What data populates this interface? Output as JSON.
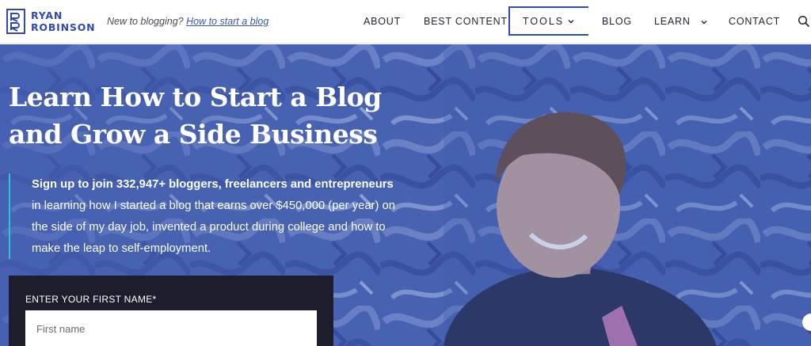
{
  "header": {
    "logo_line1": "RYAN",
    "logo_line2": "ROBINSON",
    "tagline_prefix": "New to blogging?",
    "tagline_link": "How to start a blog"
  },
  "nav": {
    "about": "ABOUT",
    "best_content": "BEST CONTENT",
    "tools": "TOOLS",
    "blog": "BLOG",
    "learn": "LEARN",
    "contact": "CONTACT"
  },
  "hero": {
    "title_line1": "Learn How to Start a Blog",
    "title_line2": "and Grow a Side Business",
    "lead_bold": "Sign up to join 332,947+ bloggers, freelancers and entrepreneurs",
    "lead_line1": "in learning how I started a blog that earns over $450,000 (per year) on",
    "lead_line2": "the side of my day job, invented a product during college and how to",
    "lead_line3": "make the leap to self-employment."
  },
  "form": {
    "label": "ENTER YOUR FIRST NAME*",
    "placeholder": "First name",
    "value": ""
  },
  "colors": {
    "brand": "#2f4bae",
    "hero_overlay": "#4a64b3",
    "accent": "#27c5d7",
    "form_bg": "#1d1d2c"
  },
  "icons": {
    "logo": "rr-monogram-icon",
    "chevron": "chevron-down-icon",
    "search": "search-icon"
  }
}
